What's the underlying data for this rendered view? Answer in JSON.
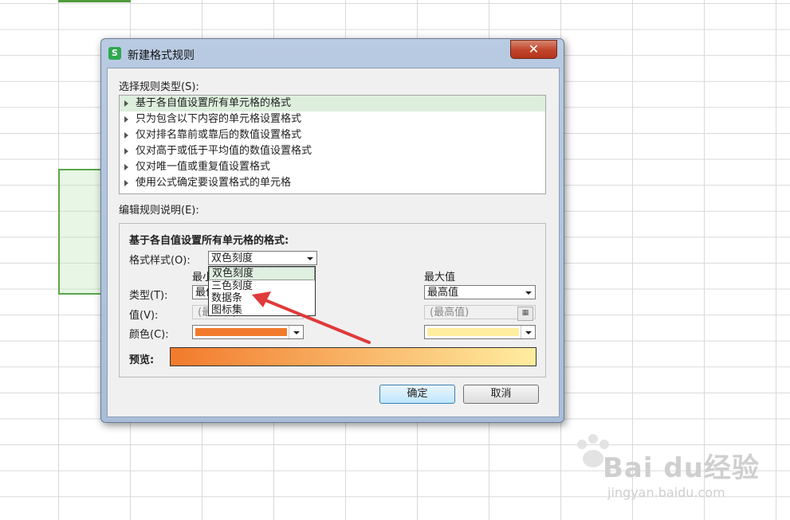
{
  "dialog": {
    "app_icon": "S",
    "title": "新建格式规则",
    "close_glyph": "✕",
    "select_rule_type_label": "选择规则类型(S):",
    "rule_types": [
      "基于各自值设置所有单元格的格式",
      "只为包含以下内容的单元格设置格式",
      "仅对排名靠前或靠后的数值设置格式",
      "仅对高于或低于平均值的数值设置格式",
      "仅对唯一值或重复值设置格式",
      "使用公式确定要设置格式的单元格"
    ],
    "selected_rule_index": 0,
    "edit_description_label": "编辑规则说明(E):",
    "description_heading": "基于各自值设置所有单元格的格式:",
    "format_style_label": "格式样式(O):",
    "format_style_value": "双色刻度",
    "format_style_options": [
      "双色刻度",
      "三色刻度",
      "数据条",
      "图标集"
    ],
    "min_header": "最小值",
    "max_header": "最大值",
    "type_label": "类型(T):",
    "min_type_value": "最低值",
    "max_type_value": "最高值",
    "value_label": "值(V):",
    "min_value_placeholder": "(最低值)",
    "max_value_placeholder": "(最高值)",
    "color_label": "颜色(C):",
    "min_color": "#f27a2c",
    "max_color": "#ffeda0",
    "preview_label": "预览:",
    "ok_label": "确定",
    "cancel_label": "取消"
  },
  "watermark": {
    "brand": "Bai du经验",
    "url": "jingyan.baidu.com"
  },
  "colors": {
    "accent_green": "#2fa84f",
    "selection_green": "#5aa64a",
    "annotation_arrow": "#e03a3a"
  }
}
